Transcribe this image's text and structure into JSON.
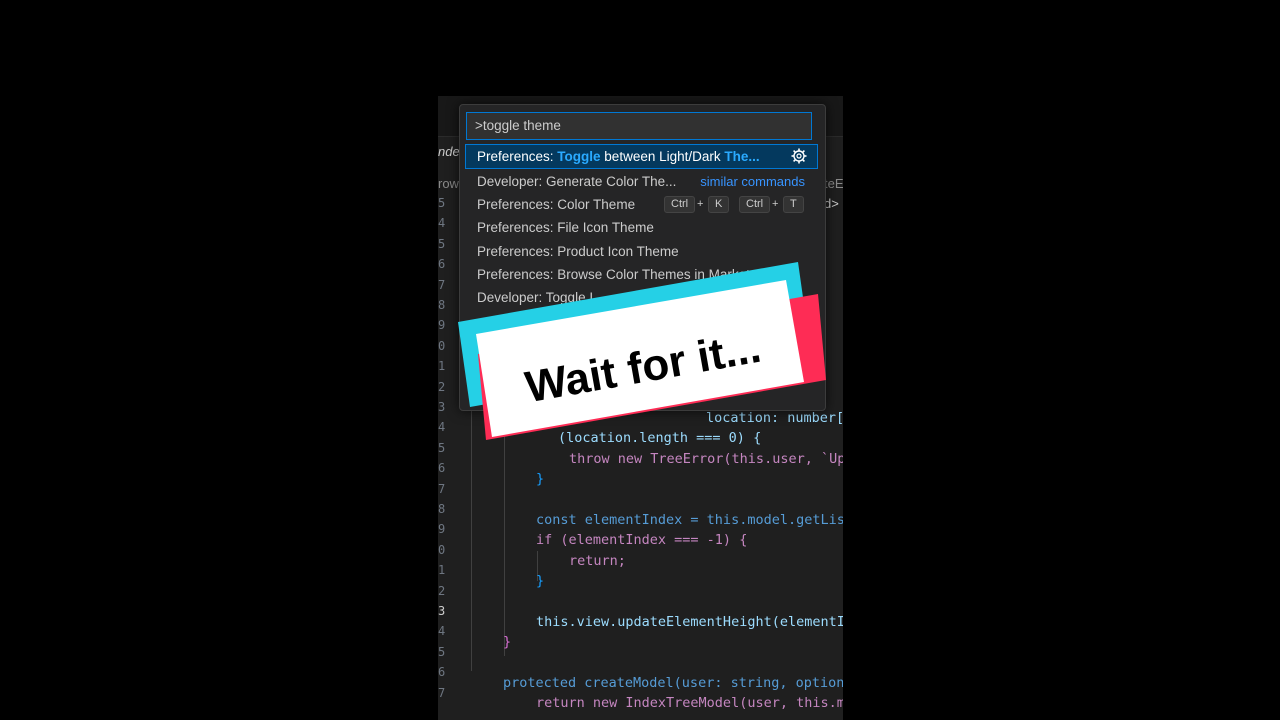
{
  "editor": {
    "tab_fragment": "nde",
    "breadcrumb_left": "row",
    "breadcrumb_right": "teE",
    "breadcrumb_tag": "d>",
    "line_numbers": [
      "5",
      "4",
      "5",
      "6",
      "7",
      "8",
      "9",
      "0",
      "1",
      "2",
      "3",
      "4",
      "5",
      "6",
      "7",
      "8",
      "9",
      "0",
      "1",
      "2",
      "3",
      "4",
      "5",
      "6",
      "7"
    ],
    "code_lines": {
      "l1": [
        "location: number[], he"
      ],
      "l2": [
        "(location.length === 0) {"
      ],
      "l3": [
        "throw new TreeError(this.user, `Up"
      ],
      "l4": [
        "}"
      ],
      "l5": [
        "const elementIndex = this.model.getLis"
      ],
      "l6": [
        "if (elementIndex === -1) {"
      ],
      "l7": [
        "return;"
      ],
      "l8": [
        "}"
      ],
      "l9": [
        "this.view.updateElementHeight(elementI"
      ],
      "l10": [
        "}"
      ],
      "l11": [
        "protected createModel(user: string, option"
      ],
      "l12": [
        "return new IndexTreeModel(user, this.m"
      ]
    }
  },
  "palette": {
    "input_value": ">toggle theme",
    "items": [
      {
        "prefix": "Preferences: ",
        "hl1": "Toggle",
        "mid": " between Light/Dark ",
        "hl2": "The...",
        "icon": "gear-icon"
      },
      {
        "label": "Developer: Generate Color The...",
        "aside": "similar commands"
      },
      {
        "label": "Preferences: Color Theme",
        "keys": [
          "Ctrl",
          "+",
          "K",
          "Ctrl",
          "+",
          "T"
        ]
      },
      {
        "label": "Preferences: File Icon Theme"
      },
      {
        "label": "Preferences: Product Icon Theme"
      },
      {
        "label": "Preferences: Browse Color Themes in Market..."
      },
      {
        "label": "Developer: Toggle I..."
      }
    ]
  },
  "overlay": {
    "caption": "Wait for it...",
    "colors": {
      "cyan": "#25d0e6",
      "pink": "#fe2c55",
      "card": "#ffffff",
      "text": "#000000"
    }
  }
}
